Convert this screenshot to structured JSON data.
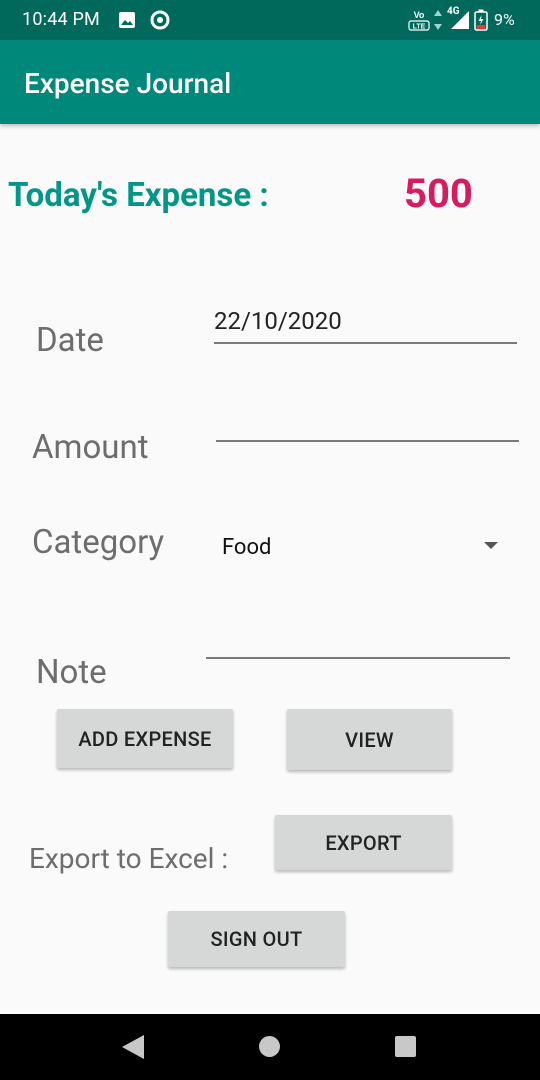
{
  "status_bar": {
    "time": "10:44 PM",
    "network": "4G",
    "battery": "9%",
    "icons": [
      "gallery-icon",
      "dnd-icon",
      "volte-icon",
      "data-arrows-icon",
      "signal-icon",
      "battery-icon"
    ]
  },
  "app_bar": {
    "title": "Expense Journal"
  },
  "summary": {
    "label": "Today's Expense :",
    "value": "500"
  },
  "form": {
    "date_label": "Date",
    "date_value": "22/10/2020",
    "amount_label": "Amount",
    "amount_value": "",
    "category_label": "Category",
    "category_value": "Food",
    "note_label": "Note",
    "note_value": ""
  },
  "buttons": {
    "add_expense": "ADD EXPENSE",
    "view": "VIEW",
    "export_label": "Export to Excel :",
    "export": "EXPORT",
    "sign_out": "SIGN OUT"
  },
  "nav_bar": {
    "icons": [
      "back-icon",
      "home-icon",
      "recents-icon"
    ]
  },
  "colors": {
    "status_bar": "#00695c",
    "app_bar": "#00897b",
    "accent_teal": "#009688",
    "expense_value": "#d81b60",
    "button_bg": "#d6d7d7"
  }
}
